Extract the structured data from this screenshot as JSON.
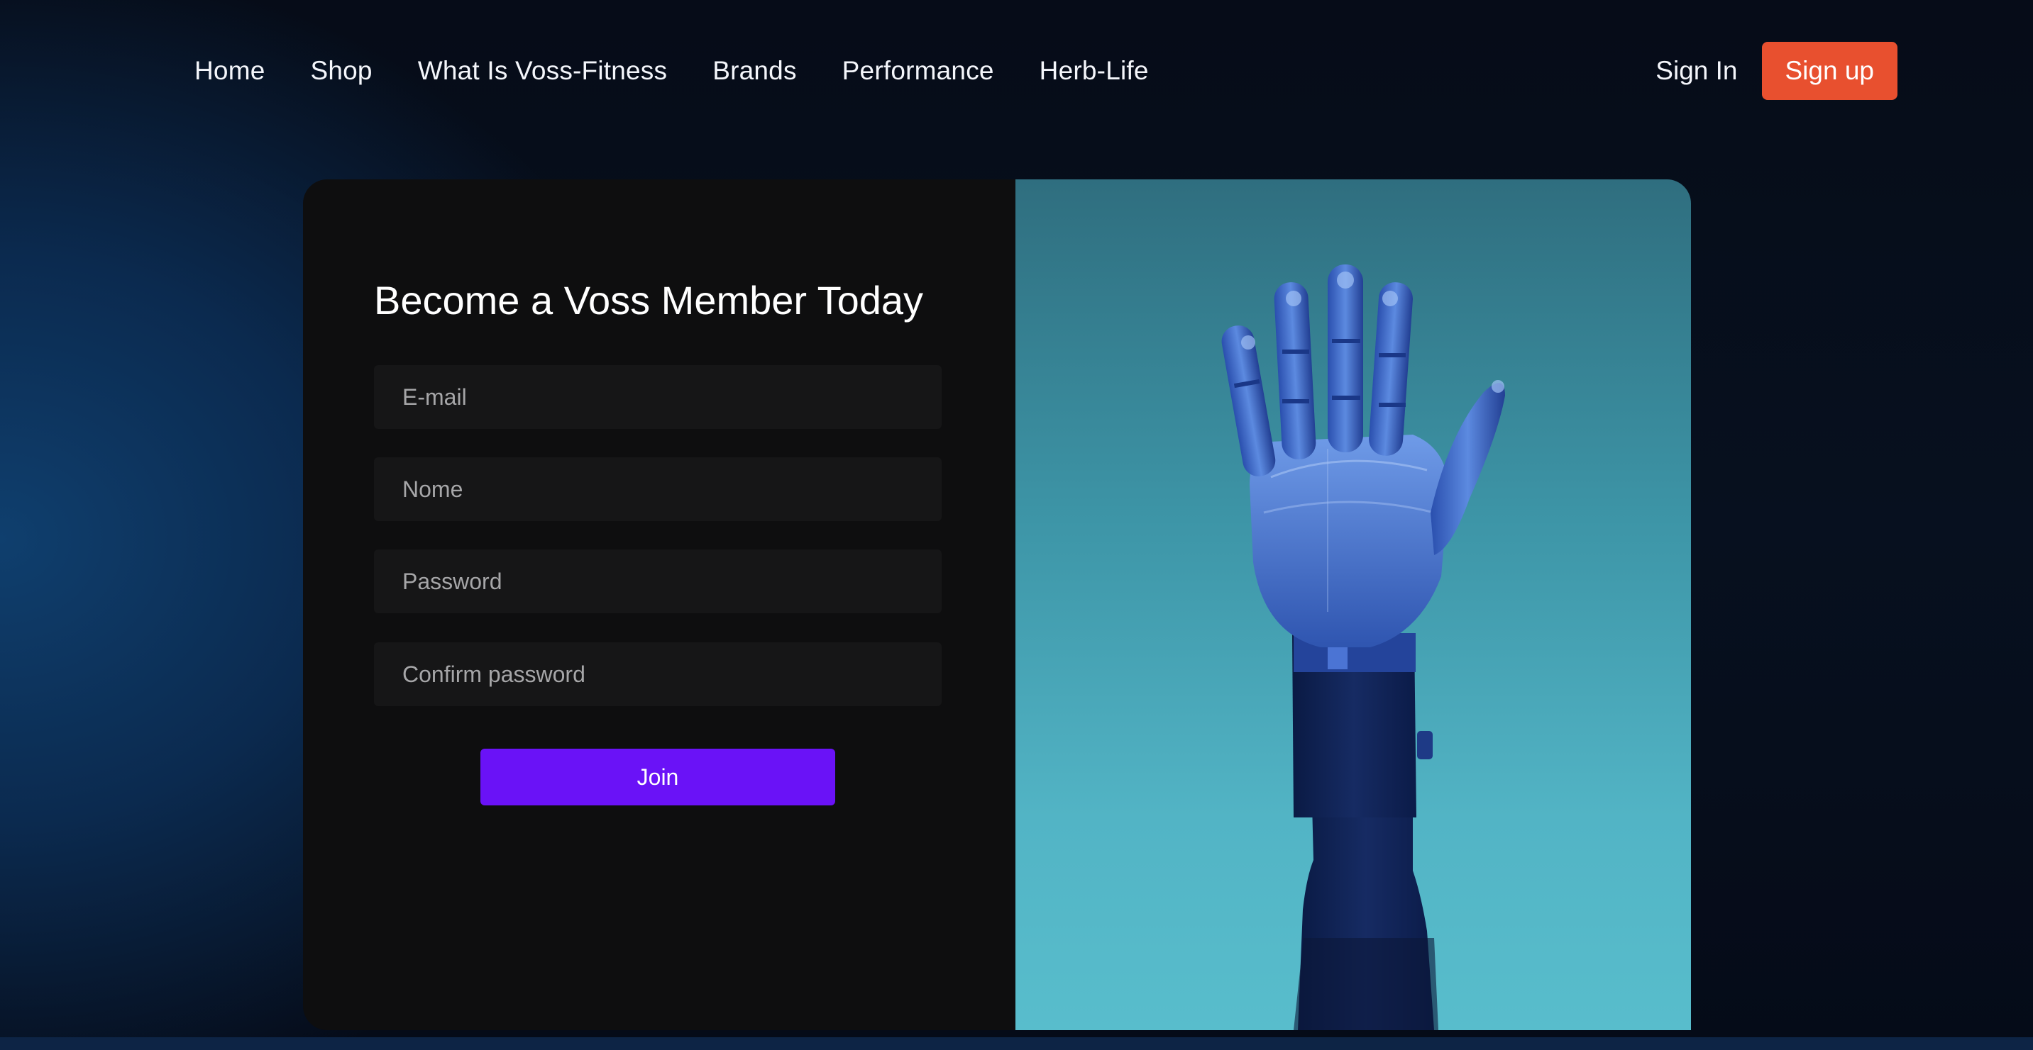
{
  "nav": {
    "links": [
      {
        "label": "Home"
      },
      {
        "label": "Shop"
      },
      {
        "label": "What Is Voss-Fitness"
      },
      {
        "label": "Brands"
      },
      {
        "label": "Performance"
      },
      {
        "label": "Herb-Life"
      }
    ],
    "sign_in": "Sign In",
    "sign_up": "Sign up"
  },
  "form": {
    "title": "Become a Voss Member Today",
    "fields": {
      "email": {
        "placeholder": "E-mail",
        "value": ""
      },
      "name": {
        "placeholder": "Nome",
        "value": ""
      },
      "password": {
        "placeholder": "Password",
        "value": ""
      },
      "confirm": {
        "placeholder": "Confirm password",
        "value": ""
      }
    },
    "submit_label": "Join"
  },
  "hero_image": {
    "subject": "robotic-hand-icon"
  },
  "colors": {
    "accent_signup": "#e8502f",
    "accent_join": "#6a12f7",
    "panel_bg": "#0e0e0f",
    "field_bg": "#161617",
    "image_bg_top": "#2f6e7f",
    "image_bg_bottom": "#58bdcc"
  }
}
